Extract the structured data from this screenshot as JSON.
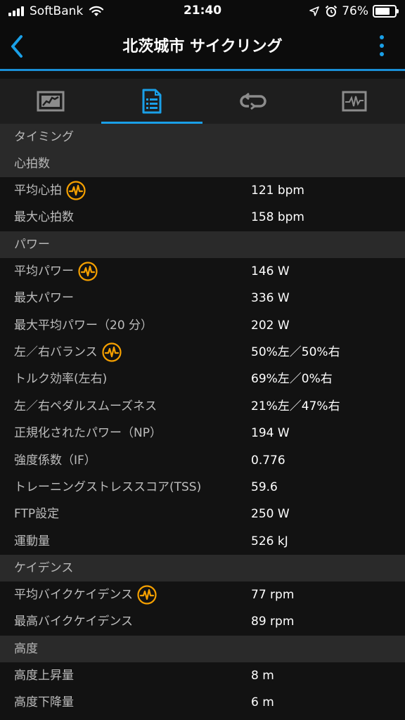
{
  "status_bar": {
    "carrier": "SoftBank",
    "time": "21:40",
    "battery_percent": "76%",
    "battery_level": 0.76,
    "icons": [
      "signal-icon",
      "wifi-icon",
      "location-arrow-icon",
      "alarm-icon",
      "battery-icon"
    ]
  },
  "header": {
    "title": "北茨城市 サイクリング",
    "back_icon": "chevron-left-icon",
    "menu_icon": "more-vertical-icon",
    "accent_color": "#1aa0e8"
  },
  "tabs": [
    {
      "icon": "map-tab-icon",
      "active": false
    },
    {
      "icon": "details-list-icon",
      "active": true
    },
    {
      "icon": "laps-loop-icon",
      "active": false
    },
    {
      "icon": "graph-chart-icon",
      "active": false
    }
  ],
  "sections": [
    {
      "title": "タイミング",
      "rows": []
    },
    {
      "title": "心拍数",
      "rows": [
        {
          "label": "平均心拍",
          "value": "121 bpm",
          "icon": "heart-rate-wave-icon"
        },
        {
          "label": "最大心拍数",
          "value": "158 bpm"
        }
      ]
    },
    {
      "title": "パワー",
      "rows": [
        {
          "label": "平均パワー",
          "value": "146 W",
          "icon": "heart-rate-wave-icon"
        },
        {
          "label": "最大パワー",
          "value": "336 W"
        },
        {
          "label": "最大平均パワー（20 分）",
          "value": "202 W"
        },
        {
          "label": "左／右バランス",
          "value": "50%左／50%右",
          "icon": "heart-rate-wave-icon"
        },
        {
          "label": "トルク効率(左右)",
          "value": "69%左／0%右"
        },
        {
          "label": "左／右ペダルスムーズネス",
          "value": "21%左／47%右"
        },
        {
          "label": "正規化されたパワー（NP）",
          "value": "194 W"
        },
        {
          "label": "強度係数（IF）",
          "value": "0.776"
        },
        {
          "label": "トレーニングストレススコア(TSS)",
          "value": "59.6"
        },
        {
          "label": "FTP設定",
          "value": "250 W"
        },
        {
          "label": "運動量",
          "value": "526 kJ"
        }
      ]
    },
    {
      "title": "ケイデンス",
      "rows": [
        {
          "label": "平均バイクケイデンス",
          "value": "77 rpm",
          "icon": "heart-rate-wave-icon"
        },
        {
          "label": "最高バイクケイデンス",
          "value": "89 rpm"
        }
      ]
    },
    {
      "title": "高度",
      "rows": [
        {
          "label": "高度上昇量",
          "value": "8 m"
        },
        {
          "label": "高度下降量",
          "value": "6 m"
        }
      ]
    }
  ]
}
